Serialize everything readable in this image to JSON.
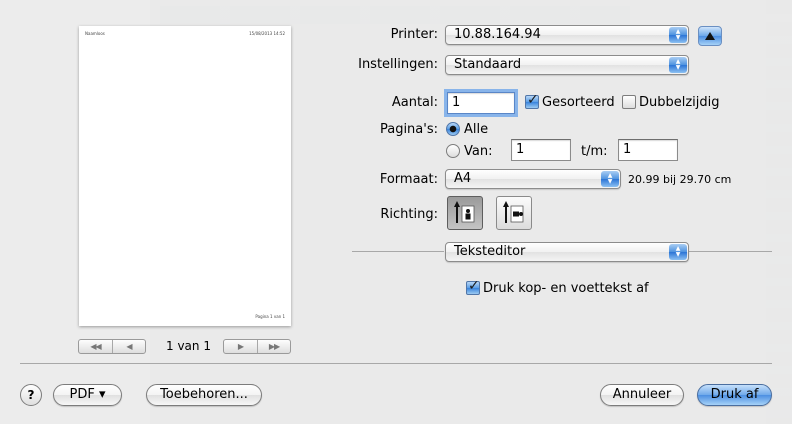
{
  "preview": {
    "header_left": "Naamloos",
    "header_right": "15/08/2013 14:52",
    "footer_right": "Pagina 1 van 1",
    "page_count": "1 van 1",
    "nav_first": "◀◀",
    "nav_prev": "◀",
    "nav_next": "▶",
    "nav_last": "▶▶"
  },
  "printer": {
    "label": "Printer:",
    "value": "10.88.164.94"
  },
  "presets": {
    "label": "Instellingen:",
    "value": "Standaard"
  },
  "copies": {
    "label": "Aantal:",
    "value": "1",
    "collated_label": "Gesorteerd",
    "collated_checked": true,
    "twosided_label": "Dubbelzijdig",
    "twosided_checked": false
  },
  "pages": {
    "label": "Pagina's:",
    "all_label": "Alle",
    "from_label": "Van:",
    "from_value": "1",
    "to_label": "t/m:",
    "to_value": "1"
  },
  "paper": {
    "label": "Formaat:",
    "value": "A4",
    "size_text": "20.99 bij 29.70 cm"
  },
  "orientation": {
    "label": "Richting:"
  },
  "section": {
    "value": "Teksteditor"
  },
  "header_footer": {
    "label": "Druk kop- en voettekst af",
    "checked": true
  },
  "buttons": {
    "help": "?",
    "pdf": "PDF ▾",
    "supplies": "Toebehoren...",
    "cancel": "Annuleer",
    "print": "Druk af"
  },
  "icons": {
    "popup_arrows": "up-down-arrows-icon",
    "disclosure": "triangle-up-icon"
  },
  "colors": {
    "accent": "#3a85dd"
  }
}
